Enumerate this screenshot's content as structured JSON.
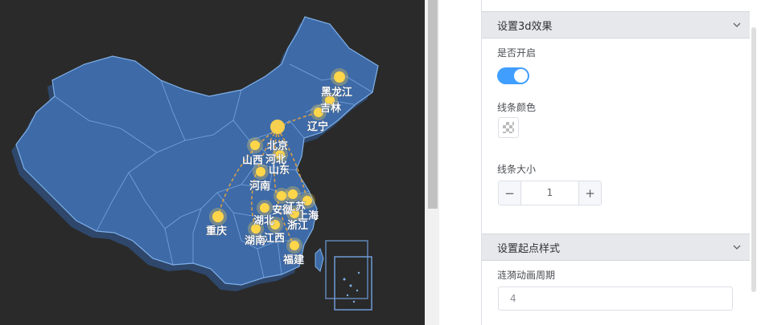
{
  "map": {
    "province_labels": [
      "黑龙江",
      "吉林",
      "辽宁",
      "北京",
      "山西",
      "河北",
      "山东",
      "河南",
      "安徽",
      "江苏",
      "上海",
      "湖北",
      "浙江",
      "重庆",
      "湖南",
      "江西",
      "福建"
    ]
  },
  "panel": {
    "section_3d": {
      "title": "设置3d效果",
      "chevron_icon": "chevron-down-icon"
    },
    "enable_label": "是否开启",
    "enable_on": true,
    "line_color_label": "线条颜色",
    "line_size_label": "线条大小",
    "line_size_value": "1",
    "minus_symbol": "−",
    "plus_symbol": "+",
    "section_start": {
      "title": "设置起点样式",
      "chevron_icon": "chevron-down-icon"
    },
    "ripple_period_label": "涟漪动画周期",
    "ripple_period_value": "4"
  },
  "colors": {
    "map_background": "#2a2a2a",
    "land": "#3e6ba8",
    "border": "#7fb0e8",
    "marker": "#ffd54a",
    "toggle_on": "#409eff"
  }
}
